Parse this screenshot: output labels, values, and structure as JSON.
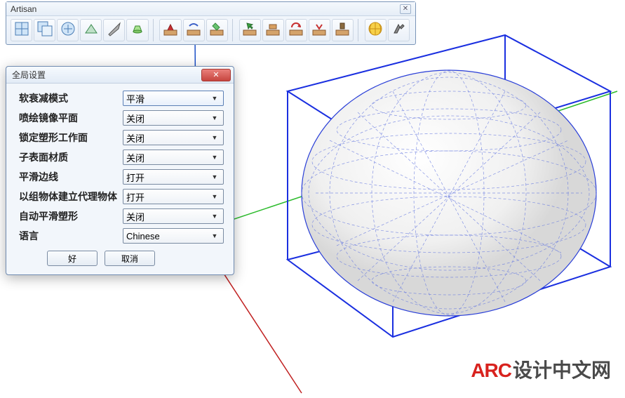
{
  "toolbar": {
    "title": "Artisan",
    "tools": [
      "subdivide-icon",
      "subdivide-group-icon",
      "unsmooth-icon",
      "crease-icon",
      "knife-icon",
      "extrude-icon",
      "sculpt-icon",
      "smooth-brush-icon",
      "paint-icon",
      "select-icon",
      "flatten-icon",
      "rotate-icon",
      "pinch-icon",
      "stamp-icon",
      "globe-icon",
      "settings-icon"
    ]
  },
  "dialog": {
    "title": "全局设置",
    "rows": [
      {
        "label": "软衰减模式",
        "value": "平滑",
        "highlight": true
      },
      {
        "label": "喷绘镜像平面",
        "value": "关闭"
      },
      {
        "label": "锁定塑形工作面",
        "value": "关闭"
      },
      {
        "label": "子表面材质",
        "value": "关闭"
      },
      {
        "label": "平滑边线",
        "value": "打开"
      },
      {
        "label": "以组物体建立代理物体",
        "value": "打开"
      },
      {
        "label": "自动平滑塑形",
        "value": "关闭"
      },
      {
        "label": "语言",
        "value": "Chinese"
      }
    ],
    "ok": "好",
    "cancel": "取消"
  },
  "watermark": {
    "arc": "ARC",
    "text": "设计中文网"
  }
}
